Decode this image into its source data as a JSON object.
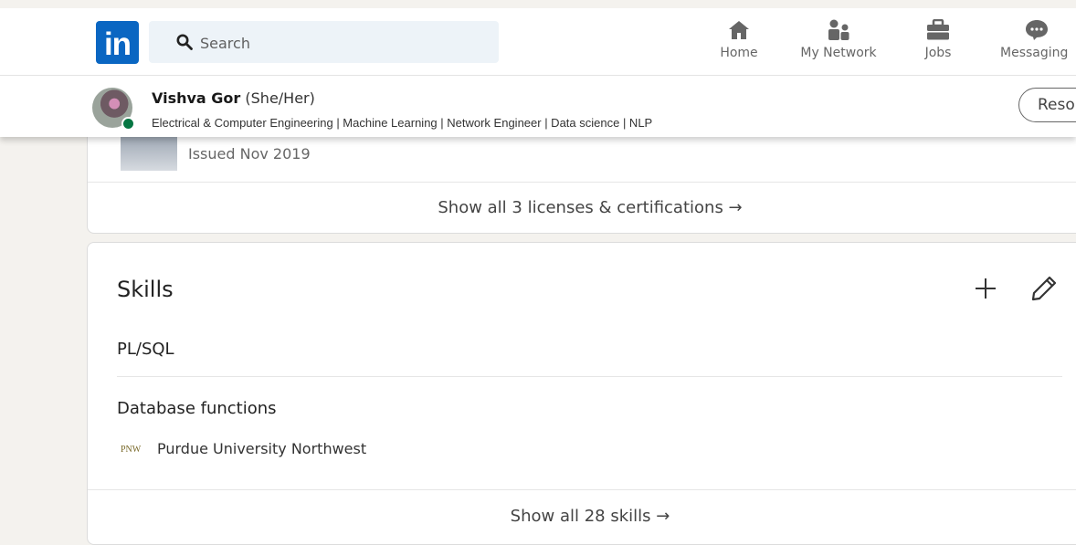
{
  "nav": {
    "logo_text": "in",
    "search_placeholder": "Search",
    "items": [
      {
        "label": "Home",
        "icon": "home-icon"
      },
      {
        "label": "My Network",
        "icon": "my-network-icon"
      },
      {
        "label": "Jobs",
        "icon": "briefcase-icon"
      },
      {
        "label": "Messaging",
        "icon": "messaging-icon"
      }
    ]
  },
  "profile_bar": {
    "name": "Vishva Gor",
    "pronouns": "(She/Her)",
    "headline": "Electrical & Computer Engineering | Machine Learning | Network Engineer | Data science | NLP",
    "resources_label": "Resources"
  },
  "licenses": {
    "issued": "Issued Nov 2019",
    "show_all": "Show all 3 licenses & certifications →"
  },
  "skills": {
    "title": "Skills",
    "items": [
      {
        "name": "PL/SQL"
      },
      {
        "name": "Database functions",
        "endorsement_logo": "PNW",
        "endorsement": "Purdue University Northwest"
      }
    ],
    "show_all": "Show all 28 skills →"
  },
  "colors": {
    "brand": "#0a66c2",
    "background": "#f4f2ee",
    "online": "#057642"
  }
}
